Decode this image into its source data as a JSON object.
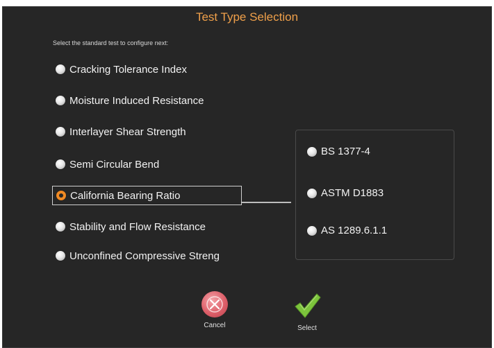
{
  "dialog": {
    "title": "Test Type Selection",
    "subtitle": "Select the standard test to configure next:"
  },
  "test_options": [
    {
      "label": "Cracking Tolerance Index",
      "selected": false
    },
    {
      "label": "Moisture Induced Resistance",
      "selected": false
    },
    {
      "label": "Interlayer Shear Strength",
      "selected": false
    },
    {
      "label": "Semi Circular Bend",
      "selected": false
    },
    {
      "label": "California Bearing Ratio",
      "selected": true
    },
    {
      "label": "Stability and Flow Resistance",
      "selected": false
    },
    {
      "label": "Unconfined Compressive Streng",
      "selected": false
    }
  ],
  "standard_options": [
    {
      "label": "BS 1377-4",
      "selected": false
    },
    {
      "label": "ASTM D1883",
      "selected": false
    },
    {
      "label": "AS 1289.6.1.1",
      "selected": false
    }
  ],
  "buttons": {
    "cancel_label": "Cancel",
    "select_label": "Select"
  },
  "colors": {
    "background": "#262626",
    "title": "#f0a04a",
    "selected_radio": "#f08a24",
    "cancel": "#dd5f69",
    "select": "#7cc43c"
  }
}
